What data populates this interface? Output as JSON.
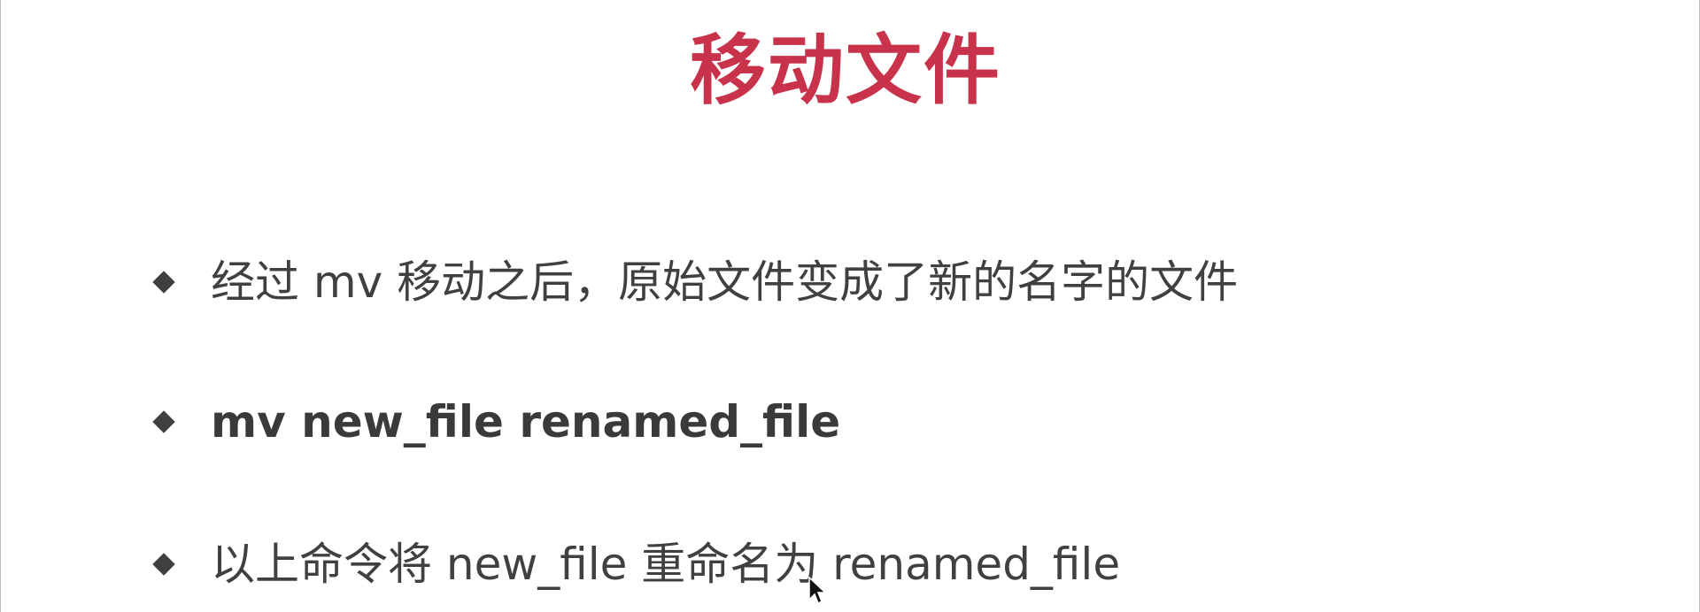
{
  "slide": {
    "title": "移动文件",
    "bullets": [
      {
        "text": "经过 mv 移动之后，原始文件变成了新的名字的文件",
        "bold": false
      },
      {
        "text": "mv new_file renamed_file",
        "bold": true
      },
      {
        "text": "以上命令将 new_file 重命名为 renamed_file",
        "bold": false
      }
    ]
  },
  "colors": {
    "title": "#c8324a",
    "text": "#404040",
    "bullet_marker": "#3f3f3f",
    "background": "#ffffff"
  },
  "icons": {
    "bullet_marker": "diamond-bullet-icon",
    "cursor": "mouse-pointer-icon"
  }
}
